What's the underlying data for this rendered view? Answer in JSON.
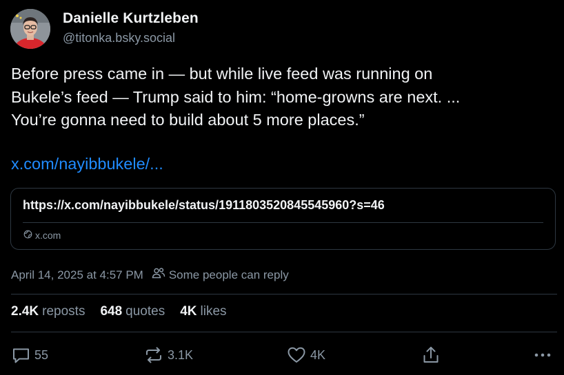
{
  "author": {
    "display_name": "Danielle Kurtzleben",
    "handle": "@titonka.bsky.social"
  },
  "post": {
    "lines": [
      "Before press came in — but while live feed was running on",
      "Bukele’s feed — Trump said to him: “home-growns are next. ...",
      "You’re gonna need to build about 5 more places.”"
    ],
    "link_text": "x.com/nayibbukele/..."
  },
  "link_card": {
    "url": "https://x.com/nayibbukele/status/1911803520845545960?s=46",
    "domain": "x.com"
  },
  "meta": {
    "timestamp": "April 14, 2025 at 4:57 PM",
    "reply_setting": "Some people can reply"
  },
  "stats": {
    "reposts_count": "2.4K",
    "reposts_label": "reposts",
    "quotes_count": "648",
    "quotes_label": "quotes",
    "likes_count": "4K",
    "likes_label": "likes"
  },
  "actions": {
    "reply_count": "55",
    "repost_count": "3.1K",
    "like_count": "4K"
  },
  "colors": {
    "background": "#000000",
    "text": "#f1f3f5",
    "muted": "#8b98a5",
    "link": "#208bfe",
    "border": "#2e3842"
  },
  "icons": {
    "reply": "speech-bubble-icon",
    "repost": "repost-arrows-icon",
    "like": "heart-icon",
    "share": "share-upload-icon",
    "more": "more-dots-icon",
    "people": "people-icon",
    "globe": "globe-icon"
  }
}
